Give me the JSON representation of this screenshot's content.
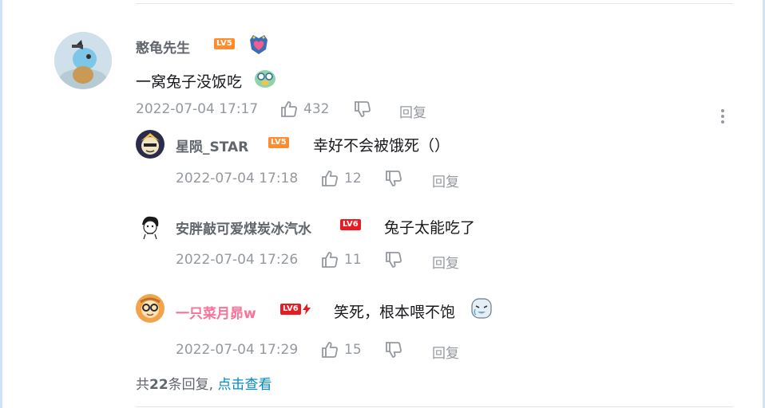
{
  "comment": {
    "username": "憨龟先生",
    "level": "LV5",
    "text": "一窝兔子没饭吃",
    "emoji_icon": "laughing-emoji-icon",
    "timestamp": "2022-07-04 17:17",
    "likes": "432",
    "reply_label": "回复",
    "colors": {
      "level_badge": "#ff8c2f"
    }
  },
  "replies": [
    {
      "username": "星陨_STAR",
      "level": "LV5",
      "text": "幸好不会被饿死（）",
      "timestamp": "2022-07-04 17:18",
      "likes": "12",
      "reply_label": "回复"
    },
    {
      "username": "安胖敲可爱煤炭冰汽水",
      "level": "LV6",
      "text": "兔子太能吃了",
      "timestamp": "2022-07-04 17:26",
      "likes": "11",
      "reply_label": "回复"
    },
    {
      "username": "一只菜月昴w",
      "level": "LV6",
      "text": "笑死，根本喂不饱",
      "emoji_icon": "crying-laugh-emoji-icon",
      "timestamp": "2022-07-04 17:29",
      "likes": "15",
      "reply_label": "回复",
      "colors": {
        "username": "#fb7299"
      }
    }
  ],
  "summary": {
    "prefix": "共",
    "count": "22",
    "suffix": "条回复,",
    "link": "点击查看"
  }
}
